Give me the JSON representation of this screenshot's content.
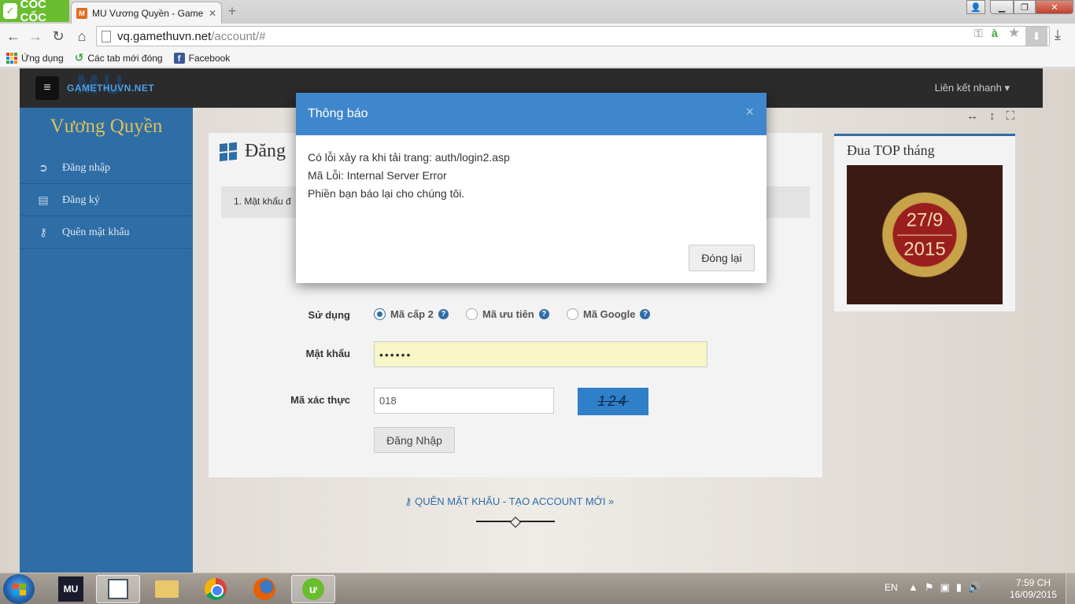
{
  "browser": {
    "brand": "CỐC CỐC",
    "tab_title": "MU Vương Quyền - Game",
    "url_host": "vq.gamethuvn.net",
    "url_path": "/account/#",
    "bookmarks": [
      {
        "label": "Ứng dụng",
        "icon": "apps-grid-icon"
      },
      {
        "label": "Các tab mới đóng",
        "icon": "recent-tabs-icon"
      },
      {
        "label": "Facebook",
        "icon": "facebook-icon"
      }
    ]
  },
  "site": {
    "logo_text": "GAMETHUVN.NET",
    "logo_big": "MU",
    "quick_links": "Liên kết nhanh ▾",
    "brand": "Vương Quyền",
    "sidebar": [
      {
        "label": "Đăng nhập",
        "icon": "sign-in-icon"
      },
      {
        "label": "Đăng ký",
        "icon": "document-icon"
      },
      {
        "label": "Quên mật khẩu",
        "icon": "key-icon"
      }
    ],
    "main_title": "Đăng",
    "step_text": "1. Mật khẩu đ"
  },
  "form": {
    "use_label": "Sử dụng",
    "options": [
      "Mã cấp 2",
      "Mã ưu tiên",
      "Mã Google"
    ],
    "selected_option": "Mã cấp 2",
    "password_label": "Mật khẩu",
    "password_value": "••••••",
    "captcha_label": "Mã xác thực",
    "captcha_value": "018",
    "captcha_image_text": "124",
    "login_button": "Đăng Nhập"
  },
  "footer": {
    "links": "QUÊN MẬT KHẨU - TẠO ACCOUNT MỚI »"
  },
  "widget": {
    "title": "Đua TOP tháng",
    "date_top": "27/9",
    "date_bottom": "2015"
  },
  "modal": {
    "title": "Thông báo",
    "close_glyph": "×",
    "line1": "Có lỗi xảy ra khi tải trang: auth/login2.asp",
    "line2": "Mã Lỗi: Internal Server Error",
    "line3": "Phiền bạn báo lại cho chúng tôi.",
    "ok_button": "Đóng lại"
  },
  "taskbar": {
    "lang": "EN",
    "time": "7:59 CH",
    "date": "16/09/2015",
    "apps": [
      "mu-game-icon",
      "document-viewer-icon",
      "file-explorer-icon",
      "chrome-icon",
      "firefox-icon",
      "coccoc-icon"
    ]
  },
  "colors": {
    "sidebar": "#2f6da6",
    "modal_header": "#3f87cc",
    "brand_gold": "#d9c25a",
    "coccoc_green": "#6abd2e"
  }
}
